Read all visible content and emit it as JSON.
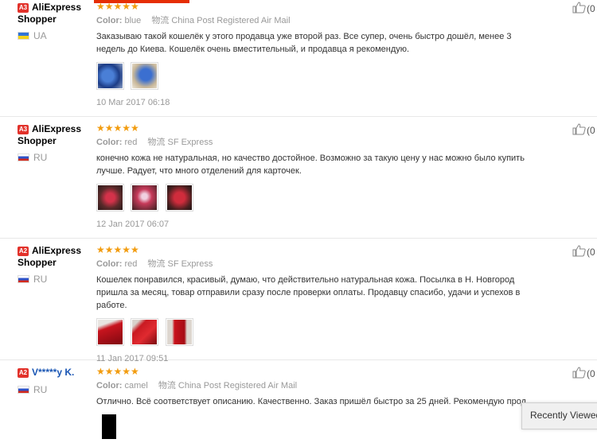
{
  "reviews": [
    {
      "level": "A3",
      "username_line1": "AliExpress",
      "username_line2": "Shopper",
      "country": "UA",
      "stars": "★★★★★",
      "color_label": "Color:",
      "color": "blue",
      "shipping": "物流 China Post Registered Air Mail",
      "text": "Заказываю такой кошелёк у этого продавца уже второй раз. Все супер, очень быстро дошёл, менее 3 недель до Киева. Кошелёк очень вместительный, и продавца я рекомендую.",
      "date": "10 Mar 2017 06:18",
      "helpful": "(0"
    },
    {
      "level": "A3",
      "username_line1": "AliExpress",
      "username_line2": "Shopper",
      "country": "RU",
      "stars": "★★★★★",
      "color_label": "Color:",
      "color": "red",
      "shipping": "物流 SF Express",
      "text": "конечно кожа не натуральная, но качество достойное. Возможно за такую цену у нас можно было купить лучше. Радует, что много отделений для карточек.",
      "date": "12 Jan 2017 06:07",
      "helpful": "(0"
    },
    {
      "level": "A2",
      "username_line1": "AliExpress",
      "username_line2": "Shopper",
      "country": "RU",
      "stars": "★★★★★",
      "color_label": "Color:",
      "color": "red",
      "shipping": "物流 SF Express",
      "text": "Кошелек понравился, красивый, думаю, что действительно натуральная кожа. Посылка в Н. Новгород пришла за месяц, товар отправили сразу после проверки оплаты. Продавцу спасибо, удачи и успехов в работе.",
      "date": "11 Jan 2017 09:51",
      "helpful": "(0"
    },
    {
      "level": "A2",
      "username_line1": "V*****y K.",
      "username_line2": "",
      "country": "RU",
      "stars": "★★★★★",
      "color_label": "Color:",
      "color": "camel",
      "shipping": "物流 China Post Registered Air Mail",
      "text": "Отлично. Всё соответствует описанию. Качественно. Заказ пришёл быстро за 25 дней. Рекомендую продавц",
      "date": "",
      "helpful": "(0"
    }
  ],
  "recently_viewed": "Recently Viewed"
}
